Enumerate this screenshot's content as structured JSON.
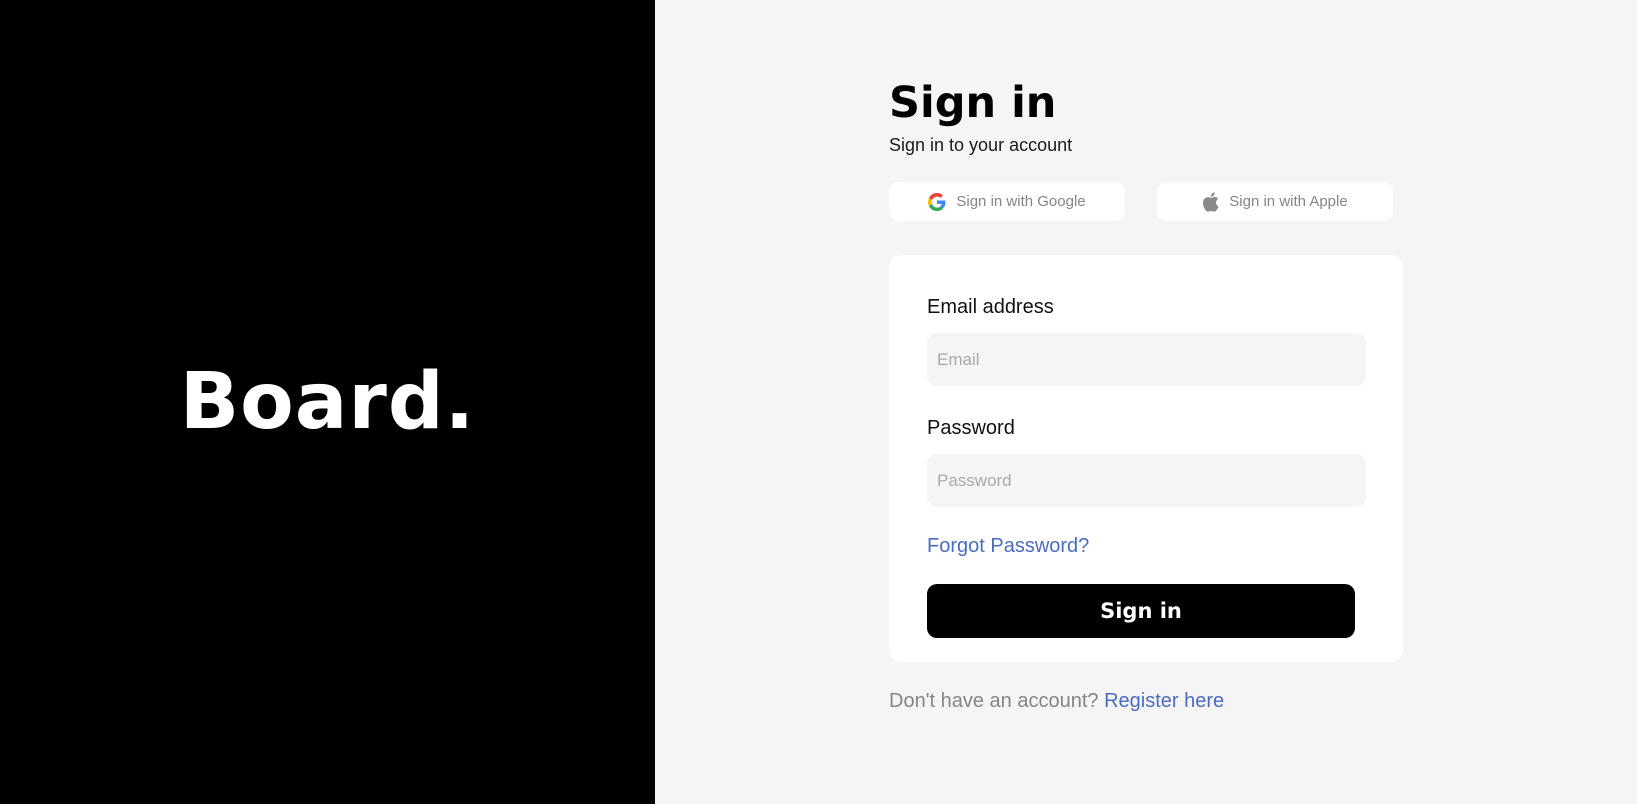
{
  "brand": {
    "logo": "Board."
  },
  "header": {
    "title": "Sign in",
    "subtitle": "Sign in to your account"
  },
  "social": {
    "google_label": "Sign in with Google",
    "apple_label": "Sign in with Apple",
    "google_icon": "google-icon",
    "apple_icon": "apple-icon"
  },
  "form": {
    "email_label": "Email address",
    "email_placeholder": "Email",
    "email_value": "",
    "password_label": "Password",
    "password_placeholder": "Password",
    "password_value": "",
    "forgot_label": "Forgot Password?",
    "submit_label": "Sign in"
  },
  "footer": {
    "prompt": "Don't have an account?",
    "register_label": "Register here"
  },
  "colors": {
    "brand_bg": "#000000",
    "page_bg": "#f5f5f5",
    "link": "#4a6cbf",
    "button_bg": "#000000"
  }
}
